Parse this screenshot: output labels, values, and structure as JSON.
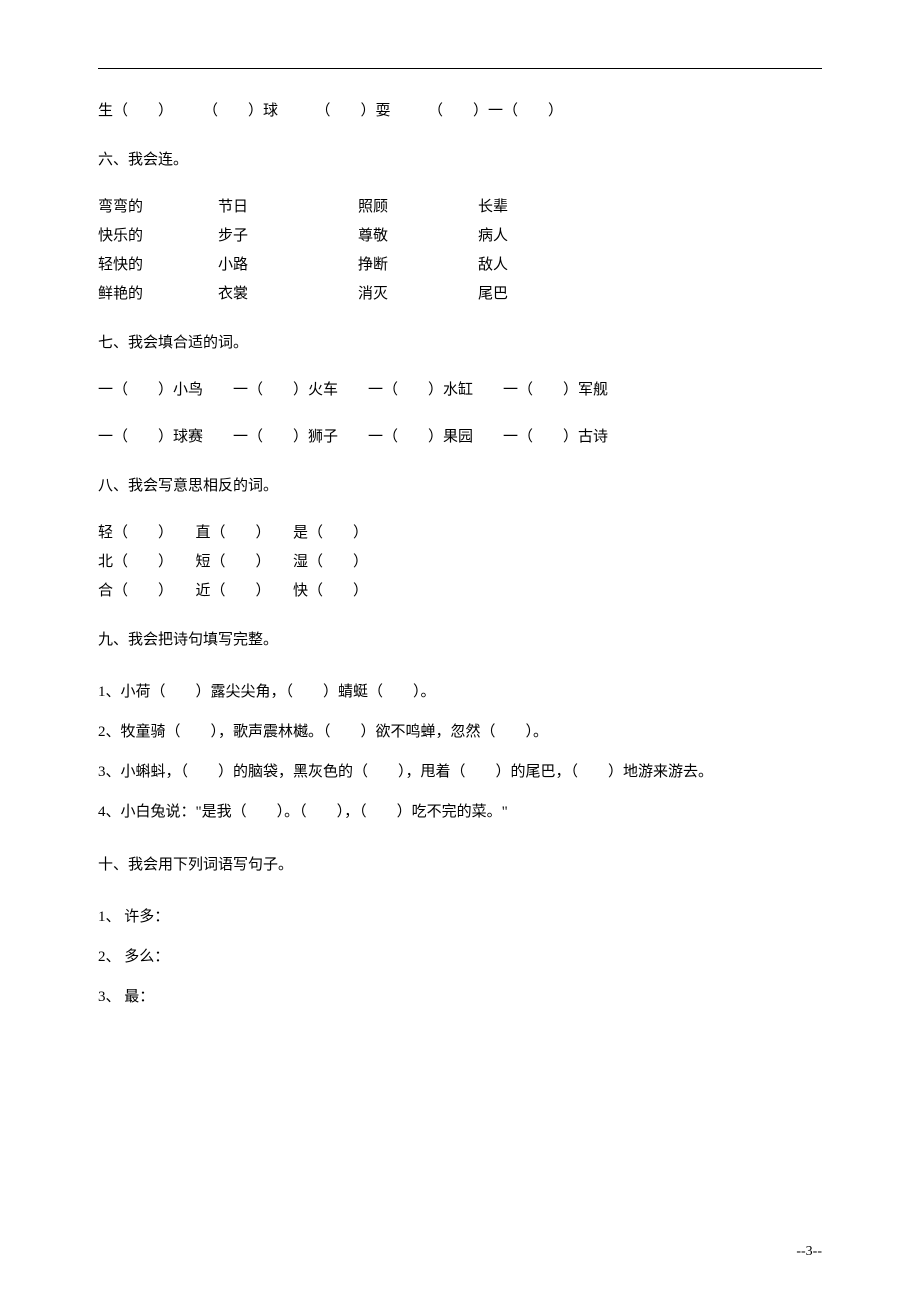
{
  "top_line": "生（　　）　　　（　　）球　　　（　　）耍　　　（　　）一（　　）",
  "section6": {
    "heading": "六、我会连。",
    "rows": [
      [
        "弯弯的",
        "节日",
        "照顾",
        "长辈"
      ],
      [
        "快乐的",
        "步子",
        "尊敬",
        "病人"
      ],
      [
        "轻快的",
        "小路",
        "挣断",
        "敌人"
      ],
      [
        "鲜艳的",
        "衣裳",
        "消灭",
        "尾巴"
      ]
    ]
  },
  "section7": {
    "heading": "七、我会填合适的词。",
    "lines": [
      "一（　　）小鸟　　一（　　）火车　　一（　　）水缸　　一（　　）军舰",
      "一（　　）球赛　　一（　　）狮子　　一（　　）果园　　一（　　）古诗"
    ]
  },
  "section8": {
    "heading": "八、我会写意思相反的词。",
    "rows": [
      "轻（　　）　　直（　　）　　是（　　）",
      "北（　　）　　短（　　）　　湿（　　）",
      "合（　　）　　近（　　）　　快（　　）"
    ]
  },
  "section9": {
    "heading": "九、我会把诗句填写完整。",
    "items": [
      "1、小荷（　　）露尖尖角，（　　）蜻蜓（　　）。",
      "2、牧童骑（　　），歌声震林樾。（　　）欲不鸣蝉，忽然（　　）。",
      "3、小蝌蚪，（　　）的脑袋，黑灰色的（　　），甩着（　　）的尾巴，（　　）地游来游去。",
      "4、小白兔说：\"是我（　　）。（　　），（　　）吃不完的菜。\""
    ]
  },
  "section10": {
    "heading": "十、我会用下列词语写句子。",
    "items": [
      "1、 许多：",
      "2、 多么：",
      "3、 最："
    ]
  },
  "footer": "--3--"
}
